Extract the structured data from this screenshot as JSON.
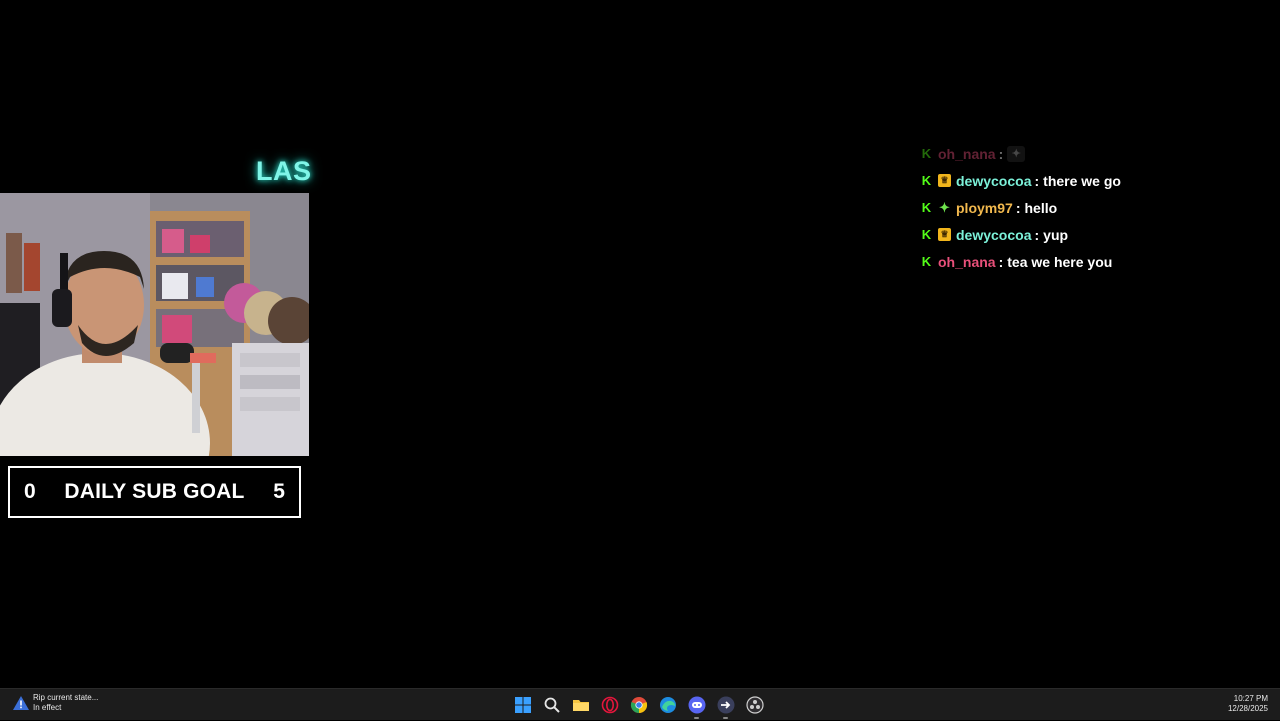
{
  "stream": {
    "ticker_text": "LAS",
    "sub_goal": {
      "current": "0",
      "label": "DAILY SUB GOAL",
      "target": "5"
    }
  },
  "chat": {
    "messages": [
      {
        "badges": [
          "kick-badge"
        ],
        "user": "oh_nana",
        "user_color": "#e8507a",
        "separator": ":",
        "text": "",
        "emote": "emote-icon",
        "dimmed": true
      },
      {
        "badges": [
          "kick-badge",
          "crown-badge"
        ],
        "user": "dewycocoa",
        "user_color": "#7cf1d9",
        "separator": ":",
        "text": "there we go"
      },
      {
        "badges": [
          "kick-badge",
          "gift-badge"
        ],
        "user": "ploym97",
        "user_color": "#f2b94e",
        "separator": ":",
        "text": "hello"
      },
      {
        "badges": [
          "kick-badge",
          "crown-badge"
        ],
        "user": "dewycocoa",
        "user_color": "#7cf1d9",
        "separator": ":",
        "text": "yup"
      },
      {
        "badges": [
          "kick-badge"
        ],
        "user": "oh_nana",
        "user_color": "#e8507a",
        "separator": ":",
        "text": "tea we here you"
      }
    ]
  },
  "taskbar": {
    "notification": {
      "title": "Rip current state...",
      "subtitle": "In effect",
      "icon": "warning-icon"
    },
    "apps": [
      {
        "name": "start-icon",
        "running": false
      },
      {
        "name": "search-icon",
        "running": false
      },
      {
        "name": "file-explorer-icon",
        "running": false
      },
      {
        "name": "opera-gx-icon",
        "running": false
      },
      {
        "name": "chrome-icon",
        "running": false
      },
      {
        "name": "edge-icon",
        "running": false
      },
      {
        "name": "discord-icon",
        "running": true
      },
      {
        "name": "app-arrow-icon",
        "running": true
      },
      {
        "name": "obs-icon",
        "running": false
      }
    ],
    "clock": {
      "time": "10:27 PM",
      "date": "12/28/2025"
    }
  },
  "colors": {
    "accent_cyan": "#7ff5e8",
    "kick_green": "#53fc18",
    "taskbar_bg": "#1c1c1c"
  }
}
